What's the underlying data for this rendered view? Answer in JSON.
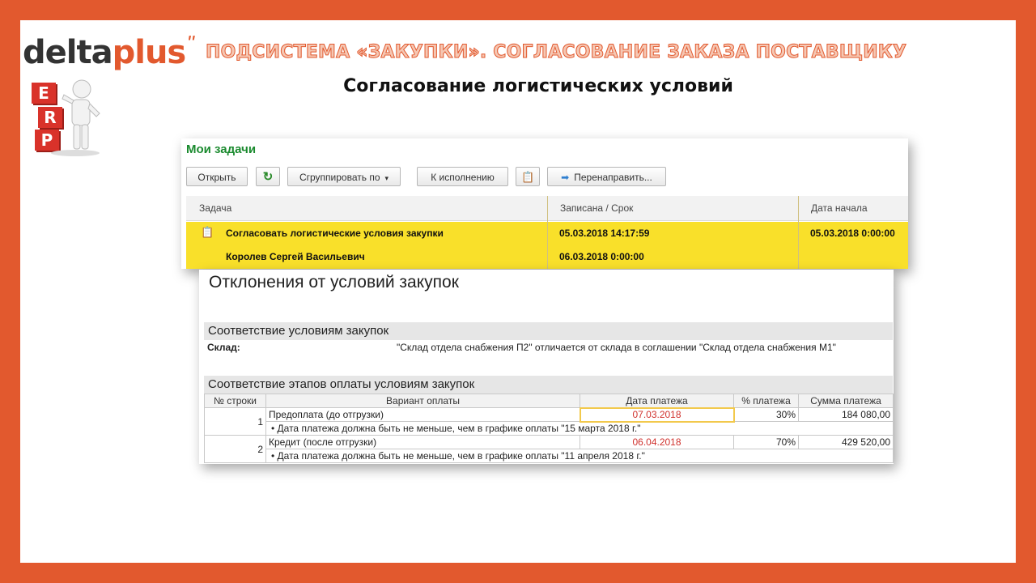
{
  "brand": {
    "name_part1": "delta",
    "name_part2": "plus",
    "erp_letters": [
      "E",
      "R",
      "P"
    ]
  },
  "slide": {
    "title": "ПОДСИСТЕМА «ЗАКУПКИ». СОГЛАСОВАНИЕ ЗАКАЗА ПОСТАВЩИКУ",
    "subtitle": "Согласование логистических условий"
  },
  "tasks": {
    "title": "Мои задачи",
    "toolbar": {
      "open": "Открыть",
      "group_by": "Сгруппировать по",
      "execute": "К исполнению",
      "redirect": "Перенаправить..."
    },
    "columns": [
      "Задача",
      "Записана / Срок",
      "Дата начала"
    ],
    "selected_task": {
      "name": "Согласовать логистические условия закупки",
      "author": "Королев Сергей Васильевич",
      "recorded": "05.03.2018 14:17:59",
      "deadline": "06.03.2018 0:00:00",
      "start_date": "05.03.2018 0:00:00"
    }
  },
  "report": {
    "title": "Отклонения от условий закупок",
    "section1": "Соответствие условиям закупок",
    "warehouse_label": "Склад:",
    "warehouse_text": "\"Склад отдела снабжения П2\" отличается от склада в соглашении \"Склад отдела снабжения М1\"",
    "section2": "Соответствие этапов оплаты условиям закупок",
    "table_headers": [
      "№ строки",
      "Вариант оплаты",
      "Дата платежа",
      "% платежа",
      "Сумма платежа"
    ],
    "rows": [
      {
        "n": "1",
        "variant": "Предоплата (до отгрузки)",
        "date": "07.03.2018",
        "percent": "30%",
        "sum": "184 080,00",
        "note": "• Дата платежа должна быть не меньше, чем в графике оплаты \"15 марта 2018 г.\""
      },
      {
        "n": "2",
        "variant": "Кредит (после отгрузки)",
        "date": "06.04.2018",
        "percent": "70%",
        "sum": "429 520,00",
        "note": "• Дата платежа должна быть не меньше, чем в графике оплаты \"11 апреля 2018 г.\""
      }
    ]
  },
  "colors": {
    "frame": "#e2592e",
    "highlight": "#f9e02a",
    "task_title": "#1a8a2e",
    "error_date": "#d0312d"
  }
}
